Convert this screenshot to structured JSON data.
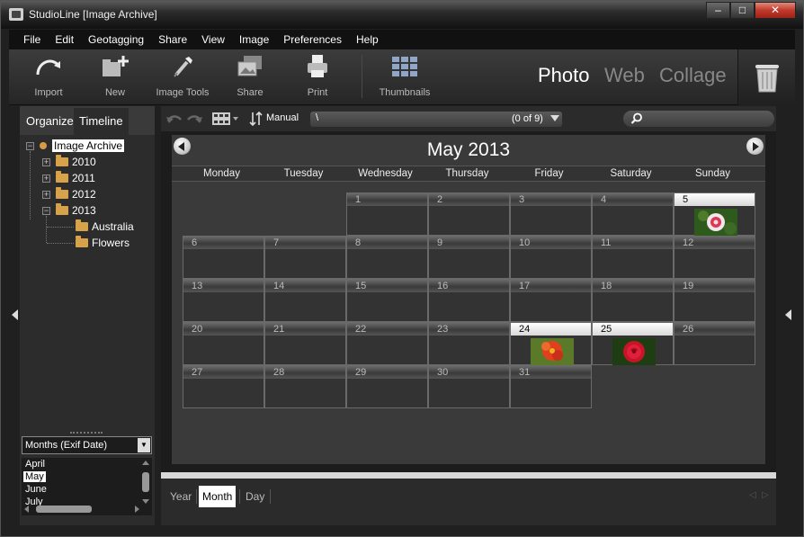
{
  "window": {
    "title": "StudioLine [Image Archive]",
    "min": "–",
    "max": "□",
    "close": "✕"
  },
  "menu": [
    "File",
    "Edit",
    "Geotagging",
    "Share",
    "View",
    "Image",
    "Preferences",
    "Help"
  ],
  "toolbar": {
    "tools": [
      {
        "label": "Import",
        "icon": "import-arrow-icon"
      },
      {
        "label": "New",
        "icon": "new-folder-icon"
      },
      {
        "label": "Image Tools",
        "icon": "pipette-icon"
      },
      {
        "label": "Share",
        "icon": "share-photos-icon"
      },
      {
        "label": "Print",
        "icon": "printer-icon"
      },
      {
        "label": "Thumbnails",
        "icon": "thumbnails-grid-icon"
      }
    ],
    "modes": [
      "Photo",
      "Web",
      "Collage"
    ],
    "active_mode": "Photo"
  },
  "left_panel": {
    "tabs": [
      "Organize",
      "Timeline"
    ],
    "active_tab": "Timeline",
    "tree": {
      "root": "Image Archive",
      "years": [
        "2010",
        "2011",
        "2012",
        "2013"
      ],
      "children_2013": [
        "Australia",
        "Flowers"
      ]
    },
    "grouping_select": "Months (Exif Date)",
    "months": [
      "April",
      "May",
      "June",
      "July"
    ],
    "selected_month": "May"
  },
  "browser": {
    "sort_label": "Manual",
    "path": "\\",
    "count": "(0 of 9)"
  },
  "calendar": {
    "title": "May 2013",
    "weekdays": [
      "Monday",
      "Tuesday",
      "Wednesday",
      "Thursday",
      "Friday",
      "Saturday",
      "Sunday"
    ],
    "first_weekday_index": 2,
    "days_in_month": 31,
    "days_with_images": [
      {
        "day": 5,
        "image": "red-white-camellia"
      },
      {
        "day": 24,
        "image": "red-orange-flower"
      },
      {
        "day": 25,
        "image": "red-rose"
      }
    ]
  },
  "view_tabs": [
    "Year",
    "Month",
    "Day"
  ],
  "active_view": "Month",
  "colors": {
    "background": "#1c1c1c",
    "calendar_bg": "#3a3a3a",
    "folder": "#d8a24a",
    "close_button": "#c0392b"
  }
}
